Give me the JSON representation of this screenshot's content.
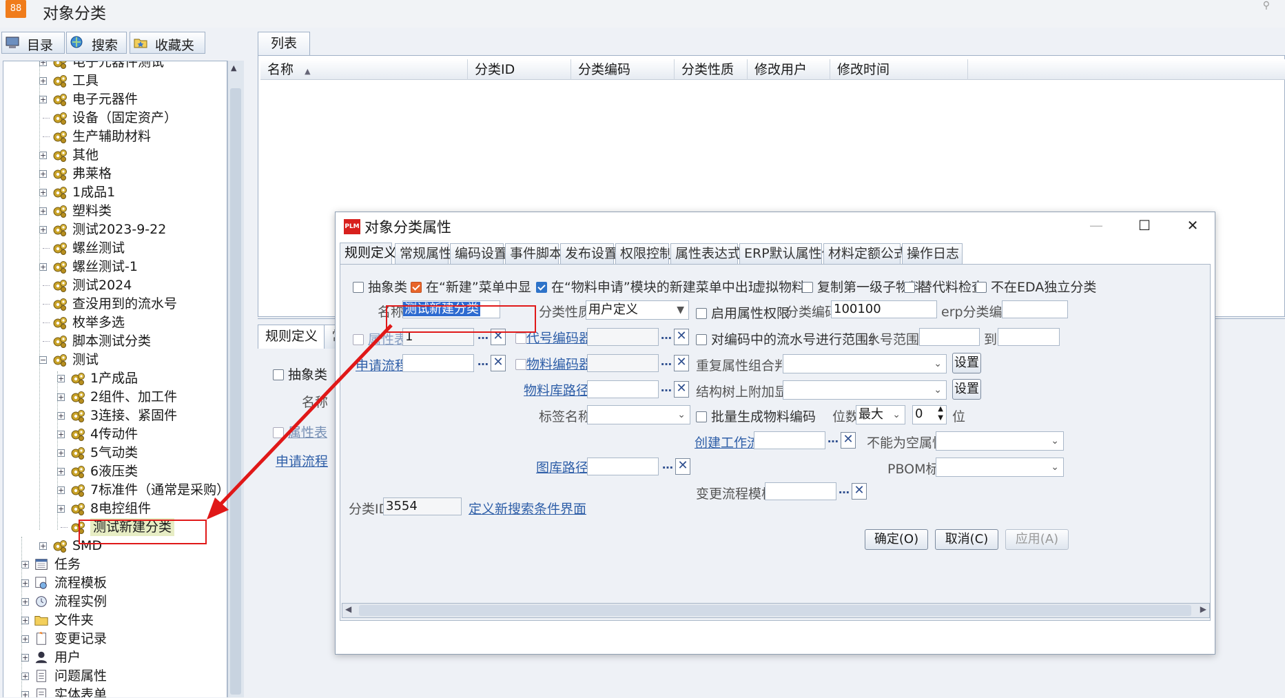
{
  "window": {
    "title": "对象分类"
  },
  "left_tabs": [
    {
      "label": "目录"
    },
    {
      "label": "搜索"
    },
    {
      "label": "收藏夹"
    }
  ],
  "tree": [
    {
      "label": "电子元器件测试",
      "level": 2,
      "expand": true
    },
    {
      "label": "工具",
      "level": 2,
      "expand": true
    },
    {
      "label": "电子元器件",
      "level": 2,
      "expand": true
    },
    {
      "label": "设备（固定资产）",
      "level": 2,
      "expand": false
    },
    {
      "label": "生产辅助材料",
      "level": 2,
      "expand": false
    },
    {
      "label": "其他",
      "level": 2,
      "expand": true
    },
    {
      "label": "弗莱格",
      "level": 2,
      "expand": true
    },
    {
      "label": "1成品1",
      "level": 2,
      "expand": true
    },
    {
      "label": "塑料类",
      "level": 2,
      "expand": true
    },
    {
      "label": "测试2023-9-22",
      "level": 2,
      "expand": true
    },
    {
      "label": "螺丝测试",
      "level": 2,
      "expand": false
    },
    {
      "label": "螺丝测试-1",
      "level": 2,
      "expand": true
    },
    {
      "label": "测试2024",
      "level": 2,
      "expand": false
    },
    {
      "label": "查没用到的流水号",
      "level": 2,
      "expand": false
    },
    {
      "label": "枚举多选",
      "level": 2,
      "expand": false
    },
    {
      "label": "脚本测试分类",
      "level": 2,
      "expand": false
    },
    {
      "label": "测试",
      "level": 2,
      "expand": "open"
    },
    {
      "label": "1产成品",
      "level": 3,
      "expand": true
    },
    {
      "label": "2组件、加工件",
      "level": 3,
      "expand": true
    },
    {
      "label": "3连接、紧固件",
      "level": 3,
      "expand": true
    },
    {
      "label": "4传动件",
      "level": 3,
      "expand": true
    },
    {
      "label": "5气动类",
      "level": 3,
      "expand": true
    },
    {
      "label": "6液压类",
      "level": 3,
      "expand": true
    },
    {
      "label": "7标准件（通常是采购）",
      "level": 3,
      "expand": true
    },
    {
      "label": "8电控组件",
      "level": 3,
      "expand": true
    },
    {
      "label": "测试新建分类",
      "level": 3,
      "expand": false,
      "selected": true
    },
    {
      "label": "SMD",
      "level": 2,
      "expand": true
    },
    {
      "label": "任务",
      "level": 1,
      "expand": true,
      "icon": "calendar-icon"
    },
    {
      "label": "流程模板",
      "level": 1,
      "expand": true,
      "icon": "workflow-template-icon"
    },
    {
      "label": "流程实例",
      "level": 1,
      "expand": true,
      "icon": "workflow-instance-icon"
    },
    {
      "label": "文件夹",
      "level": 1,
      "expand": true,
      "icon": "folder-icon"
    },
    {
      "label": "变更记录",
      "level": 1,
      "expand": true,
      "icon": "change-record-icon"
    },
    {
      "label": "用户",
      "level": 1,
      "expand": true,
      "icon": "user-icon"
    },
    {
      "label": "问题属性",
      "level": 1,
      "expand": true,
      "icon": "document-icon"
    },
    {
      "label": "实体表单",
      "level": 1,
      "expand": true,
      "icon": "form-icon"
    }
  ],
  "list": {
    "tab": "列表",
    "columns": [
      "名称",
      "分类ID",
      "分类编码",
      "分类性质",
      "修改用户",
      "修改时间"
    ]
  },
  "lower": {
    "tab1": "规则定义",
    "tab2": "常",
    "abstract_label": "抽象类",
    "name_label": "名称",
    "attr_table_label": "属性表",
    "apply_flow_label": "申请流程"
  },
  "dialog": {
    "title": "对象分类属性",
    "tabs": [
      "规则定义",
      "常规属性",
      "编码设置",
      "事件脚本",
      "发布设置",
      "权限控制",
      "属性表达式",
      "ERP默认属性值",
      "材料定额公式",
      "操作日志"
    ],
    "row1": {
      "abstract": "抽象类",
      "show_in_new": "在“新建”菜单中显示",
      "show_in_material": "在“物料申请”模块的新建菜单中出现",
      "virtual": "虚拟物料",
      "copy_first": "复制第一级子物料",
      "substitute": "替代料检查",
      "not_eda": "不在EDA独立分类"
    },
    "name_label": "名称",
    "name_value": "测试新建分类",
    "nature_label": "分类性质",
    "nature_value": "用户定义",
    "enable_attr_perm": "启用属性权限",
    "code_label": "分类编码",
    "code_value": "100100",
    "erp_code_label": "erp分类编码",
    "attr_table_label": "属性表",
    "attr_table_value": "1",
    "code_gen_label": "代号编码器",
    "range_constraint": "对编码中的流水号进行范围约束",
    "serial_range_label": "流水号范围",
    "to_label": "到",
    "apply_flow_label": "申请流程",
    "material_gen_label": "物料编码器",
    "dup_attr_label": "重复属性组合判断",
    "set_label": "设置",
    "lib_path_label": "物料库路径",
    "struct_tree_label": "结构树上附加显示",
    "tag_name_label": "标签名称",
    "batch_gen": "批量生成物料编码",
    "digits_label": "位数",
    "digits_value": "最大",
    "spin_value": "0",
    "unit_label": "位",
    "create_flow_label": "创建工作流",
    "not_empty_label": "不能为空属性",
    "drawing_path_label": "图库路径",
    "pbom_label": "PBOM标签",
    "change_tpl_label": "变更流程模板",
    "id_label": "分类ID",
    "id_value": "3554",
    "define_search_link": "定义新搜索条件界面",
    "ok": "确定(O)",
    "cancel": "取消(C)",
    "apply": "应用(A)"
  },
  "colors": {
    "accent": "#2e73c9",
    "highlight_box": "#e01818",
    "arrow": "#e01818"
  }
}
